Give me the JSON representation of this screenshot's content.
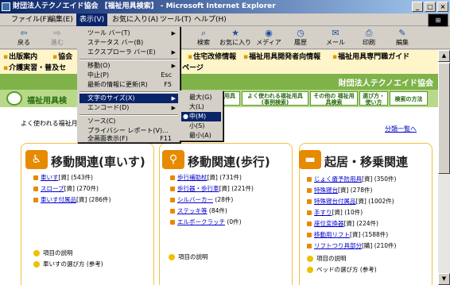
{
  "window": {
    "title": "財団法人テクノエイド協会 【福祉用具検索】 - Microsoft Internet Explorer"
  },
  "menubar": [
    {
      "label": "ファイル(F)"
    },
    {
      "label": "編集(E)"
    },
    {
      "label": "表示(V)"
    },
    {
      "label": "お気に入り(A)"
    },
    {
      "label": "ツール(T)"
    },
    {
      "label": "ヘルプ(H)"
    }
  ],
  "toolbar": [
    {
      "label": "戻る",
      "icon": "back-icon"
    },
    {
      "label": "進む",
      "icon": "forward-icon"
    },
    {
      "label": "検索",
      "icon": "search-icon"
    },
    {
      "label": "お気に入り",
      "icon": "favorites-icon"
    },
    {
      "label": "メディア",
      "icon": "media-icon"
    },
    {
      "label": "履歴",
      "icon": "history-icon"
    },
    {
      "label": "メール",
      "icon": "mail-icon"
    },
    {
      "label": "印刷",
      "icon": "print-icon"
    },
    {
      "label": "編集",
      "icon": "edit-icon"
    }
  ],
  "view_menu": {
    "items": [
      {
        "label": "ツール バー(T)"
      },
      {
        "label": "ステータス バー(B)"
      },
      {
        "label": "エクスプローラ バー(E)"
      },
      {
        "label": "移動(O)"
      },
      {
        "label": "中止(P)",
        "shortcut": "Esc"
      },
      {
        "label": "最新の情報に更新(R)",
        "shortcut": "F5"
      },
      {
        "label": "文字のサイズ(X)"
      },
      {
        "label": "エンコード(D)"
      },
      {
        "label": "ソース(C)"
      },
      {
        "label": "プライバシー レポート(V)..."
      },
      {
        "label": "全画面表示(F)",
        "shortcut": "F11"
      }
    ]
  },
  "text_size_menu": {
    "items": [
      {
        "label": "最大(G)"
      },
      {
        "label": "大(L)"
      },
      {
        "label": "中(M)"
      },
      {
        "label": "小(S)"
      },
      {
        "label": "最小(A)"
      }
    ],
    "selected": "中(M)"
  },
  "page": {
    "top_links": [
      {
        "label": "出版案内"
      },
      {
        "label": "協会"
      },
      {
        "label": "住宅改修情報"
      },
      {
        "label": "福祉用具開発者向情報"
      },
      {
        "label": "福祉用具専門職ガイド"
      },
      {
        "label": "介護実習・普及セ"
      },
      {
        "label": "ページ"
      }
    ],
    "org_name": "財団法人テクノエイド協会",
    "section_title": "福祉用具検",
    "nav_tabs": [
      {
        "label": "用具"
      },
      {
        "label": "よく使われる福祉用具 (事例検索)"
      },
      {
        "label": "その他の 福祉用具検索"
      },
      {
        "label": "選び方・ 使い方"
      },
      {
        "label": "検索の方法"
      }
    ],
    "intro": "よく使われる福祉月",
    "list_link": "分類一覧へ",
    "columns": [
      {
        "title": "移動関連(車いす)",
        "items": [
          {
            "name": "車いす",
            "tag": "[資]",
            "count": "(543件)"
          },
          {
            "name": "スロープ",
            "tag": "[資]",
            "count": "(270件)"
          },
          {
            "name": "車いす付属品",
            "tag": "[資]",
            "count": "(286件)"
          }
        ],
        "bottom": [
          {
            "label": "項目の説明"
          },
          {
            "label": "車いすの選び方 (参考)"
          }
        ]
      },
      {
        "title": "移動関連(歩行)",
        "items": [
          {
            "name": "歩行補助杖",
            "tag": "[資]",
            "count": "(731件)"
          },
          {
            "name": "歩行器・歩行車",
            "tag": "[資]",
            "count": "(221件)"
          },
          {
            "name": "シルバーカー",
            "tag": "",
            "count": "(28件)"
          },
          {
            "name": "ステッキ等",
            "tag": "",
            "count": "(84件)"
          },
          {
            "name": "エルボークラッチ",
            "tag": "",
            "count": "(0件)"
          }
        ],
        "bottom": [
          {
            "label": "項目の説明"
          }
        ]
      },
      {
        "title": "起居・移乗関連",
        "items": [
          {
            "name": "じょく瘡予防用具",
            "tag": "[資]",
            "count": "(350件)"
          },
          {
            "name": "特殊寝台",
            "tag": "[資]",
            "count": "(278件)"
          },
          {
            "name": "特殊寝台付属品",
            "tag": "[資]",
            "count": "(1002件)"
          },
          {
            "name": "手すり",
            "tag": "[資]",
            "count": "(10件)"
          },
          {
            "name": "座位変換器",
            "tag": "[資]",
            "count": "(224件)"
          },
          {
            "name": "移動用リフト",
            "tag": "[資]",
            "count": "(1588件)"
          },
          {
            "name": "リフトつり具部分",
            "tag": "[購]",
            "count": "(210件)"
          }
        ],
        "bottom": [
          {
            "label": "項目の説明"
          },
          {
            "label": "ベッドの選び方 (参考)"
          }
        ]
      }
    ]
  },
  "colors": {
    "title_gradient_start": "#0a246a",
    "accent_orange": "#e68a00",
    "green_bar": "#7fb34a",
    "menu_highlight": "#0a246a"
  }
}
